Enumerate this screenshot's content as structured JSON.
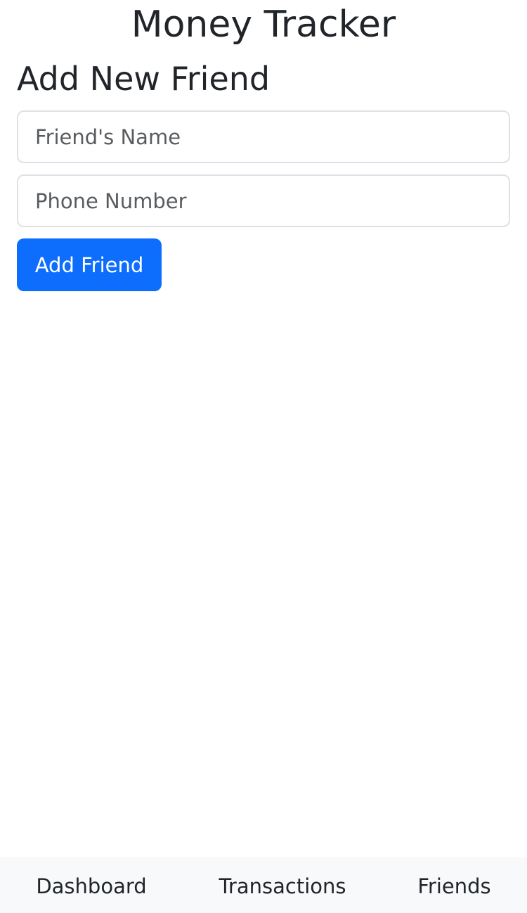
{
  "app": {
    "title": "Money Tracker"
  },
  "form": {
    "heading": "Add New Friend",
    "name_field": {
      "placeholder": "Friend's Name",
      "value": ""
    },
    "phone_field": {
      "placeholder": "Phone Number",
      "value": ""
    },
    "submit_label": "Add Friend"
  },
  "nav": {
    "items": [
      {
        "label": "Dashboard"
      },
      {
        "label": "Transactions"
      },
      {
        "label": "Friends"
      }
    ]
  },
  "colors": {
    "primary": "#0d6efd",
    "nav_background": "#f8f9fa",
    "text": "#212529",
    "border": "#dee2e6"
  }
}
